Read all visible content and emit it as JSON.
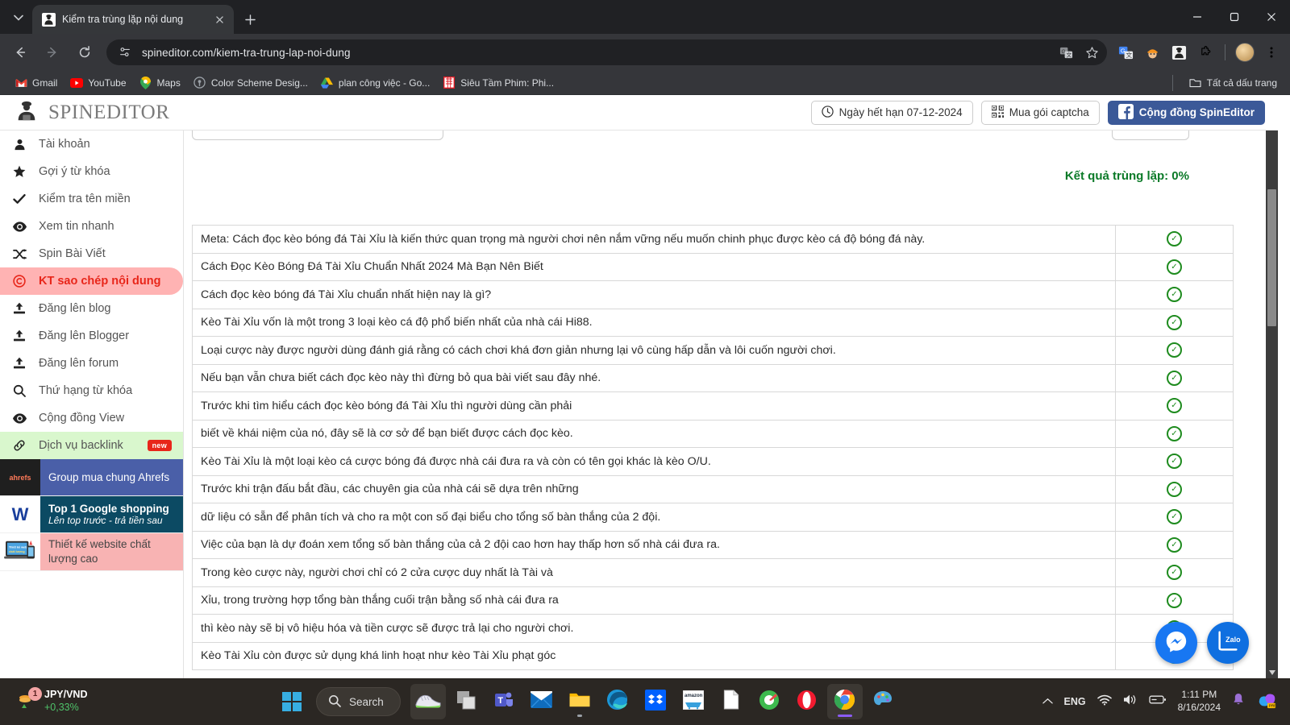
{
  "browser": {
    "tab": {
      "title": "Kiểm tra trùng lặp nội dung",
      "favicon": "spineditor-favicon"
    },
    "new_tab_label": "+",
    "url": "spineditor.com/kiem-tra-trung-lap-noi-dung",
    "window_controls": {
      "minimize": "minimize-icon",
      "maximize": "maximize-icon",
      "close": "close-icon"
    },
    "bookmarks": [
      {
        "label": "Gmail",
        "icon": "gmail-icon"
      },
      {
        "label": "YouTube",
        "icon": "youtube-icon"
      },
      {
        "label": "Maps",
        "icon": "maps-icon"
      },
      {
        "label": "Color Scheme Desig...",
        "icon": "color-scheme-icon"
      },
      {
        "label": "plan công việc - Go...",
        "icon": "google-drive-icon"
      },
      {
        "label": "Siêu Tầm Phim: Phi...",
        "icon": "movie-icon"
      }
    ],
    "all_bookmarks_label": "Tất cả dấu trang"
  },
  "app": {
    "brand": "SPINEDITOR",
    "header_buttons": [
      {
        "label": "Ngày hết hạn 07-12-2024",
        "icon": "clock-icon"
      },
      {
        "label": "Mua gói captcha",
        "icon": "qr-icon"
      },
      {
        "label": "Cộng đồng SpinEditor",
        "icon": "facebook-icon"
      }
    ],
    "sidebar": {
      "items": [
        {
          "label": "Tài khoản",
          "icon": "user-icon",
          "active": false
        },
        {
          "label": "Gợi ý từ khóa",
          "icon": "star-icon",
          "active": false
        },
        {
          "label": "Kiểm tra tên miền",
          "icon": "check-icon",
          "active": false
        },
        {
          "label": "Xem tin nhanh",
          "icon": "eye-icon",
          "active": false
        },
        {
          "label": "Spin Bài Viết",
          "icon": "shuffle-icon",
          "active": false
        },
        {
          "label": "KT sao chép nội dung",
          "icon": "copyright-icon",
          "active": true
        },
        {
          "label": "Đăng lên blog",
          "icon": "upload-icon",
          "active": false
        },
        {
          "label": "Đăng lên Blogger",
          "icon": "upload-icon",
          "active": false
        },
        {
          "label": "Đăng lên forum",
          "icon": "upload-icon",
          "active": false
        },
        {
          "label": "Thứ hạng từ khóa",
          "icon": "search-icon",
          "active": false
        },
        {
          "label": "Cộng đồng View",
          "icon": "eye-icon",
          "active": false
        }
      ],
      "backlink": {
        "label": "Dịch vụ backlink",
        "icon": "link-icon",
        "badge": "new"
      },
      "ads": [
        {
          "title": "Group mua chung Ahrefs",
          "subtitle": "",
          "thumb": "ahrefs"
        },
        {
          "title": "Top 1 Google shopping",
          "subtitle": "Lên top trước - trả tiền sau",
          "thumb": "W"
        },
        {
          "title": "Thiết kế website chất lượng cao",
          "subtitle": "",
          "thumb": "website"
        }
      ]
    },
    "result_label": "Kết quả trùng lặp: 0%",
    "table": {
      "status_icon": "check-circle-icon",
      "rows": [
        "Meta: Cách đọc kèo bóng đá Tài Xỉu là kiến thức quan trọng mà người chơi nên nắm vững nếu muốn chinh phục được kèo cá độ bóng đá này.",
        "Cách Đọc Kèo Bóng Đá Tài Xỉu Chuẩn Nhất 2024 Mà Bạn Nên Biết",
        "Cách đọc kèo bóng đá Tài Xỉu chuẩn nhất hiện nay là gì?",
        "Kèo Tài Xỉu vốn là một trong 3 loại kèo cá độ phổ biến nhất của nhà cái Hi88.",
        "Loại cược này được người dùng đánh giá rằng có cách chơi khá đơn giản nhưng lại vô cùng hấp dẫn và lôi cuốn người chơi.",
        "Nếu bạn vẫn chưa biết cách đọc kèo này thì đừng bỏ qua bài viết sau đây nhé.",
        "Trước khi tìm hiểu cách đọc kèo bóng đá Tài Xỉu thì người dùng cần phải",
        "biết về khái niệm của nó, đây sẽ là cơ sở để bạn biết được cách đọc kèo.",
        "Kèo Tài Xỉu là một loại kèo cá cược bóng đá được nhà cái đưa ra và còn có tên gọi khác là kèo O/U.",
        "Trước khi trận đấu bắt đầu, các chuyên gia của nhà cái sẽ dựa trên những",
        "dữ liệu có sẵn để phân tích và cho ra một con số đại biểu cho tổng số bàn thắng của 2 đội.",
        "Việc của bạn là dự đoán xem tổng số bàn thắng của cả 2 đội cao hơn hay thấp hơn số nhà cái đưa ra.",
        "Trong kèo cược này, người chơi chỉ có 2 cửa cược duy nhất là Tài và",
        "Xỉu, trong trường hợp tổng bàn thắng cuối trận bằng số nhà cái đưa ra",
        "thì kèo này sẽ bị vô hiệu hóa và tiền cược sẽ được trả lại cho người chơi.",
        "Kèo Tài Xỉu còn được sử dụng khá linh hoạt như kèo Tài Xỉu phạt góc"
      ]
    },
    "chat": [
      {
        "name": "messenger-chat-button",
        "icon": "messenger-icon"
      },
      {
        "name": "zalo-chat-button",
        "icon": "zalo-icon",
        "label": "Zalo"
      }
    ]
  },
  "taskbar": {
    "widget": {
      "symbol": "JPY/VND",
      "change": "+0,33%",
      "badge": "1"
    },
    "search_placeholder": "Search",
    "apps": [
      "shoe-app-icon",
      "windows-copy-icon",
      "teams-icon",
      "mail-icon",
      "file-explorer-icon",
      "edge-icon",
      "dropbox-icon",
      "amazon-icon",
      "notepad-icon",
      "tool-icon",
      "opera-icon",
      "chrome-icon",
      "paint-icon"
    ],
    "tray": {
      "chevron": "show-hidden-icons",
      "language": "ENG",
      "wifi": "wifi-icon",
      "volume": "volume-icon",
      "battery": "battery-icon",
      "time": "1:11 PM",
      "date": "8/16/2024",
      "notification": "bell-icon",
      "copilot": "copilot-icon"
    }
  },
  "colors": {
    "accent_red": "#e8261a",
    "green": "#0b7a28",
    "fb_blue": "#3b5998",
    "chrome_dark": "#202124"
  }
}
